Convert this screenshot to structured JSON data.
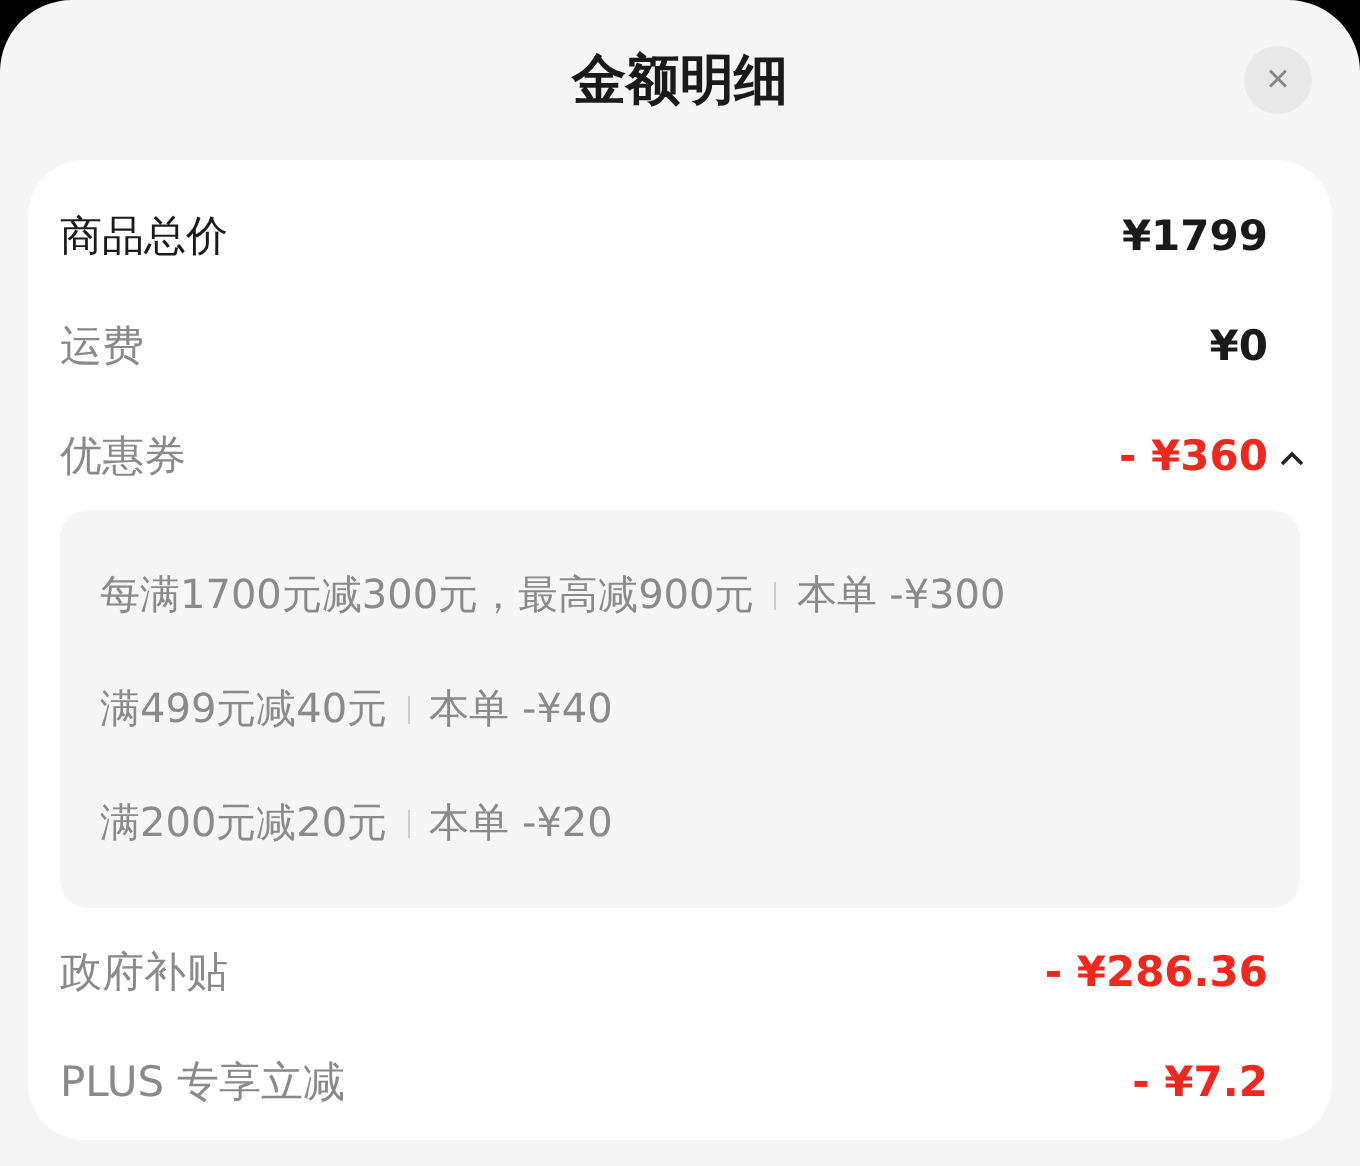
{
  "title": "金额明细",
  "close": "×",
  "rows": [
    {
      "label": "商品总价",
      "value": "¥1799",
      "kind": "total"
    },
    {
      "label": "运费",
      "value": "¥0",
      "kind": "charge"
    },
    {
      "label": "优惠券",
      "value": "- ¥360",
      "kind": "discount",
      "expanded": true,
      "details": [
        {
          "rule": "每满1700元减300元，最高减900元",
          "amount": "本单 -¥300"
        },
        {
          "rule": "满499元减40元",
          "amount": "本单 -¥40"
        },
        {
          "rule": "满200元减20元",
          "amount": "本单 -¥20"
        }
      ]
    },
    {
      "label": "政府补贴",
      "value": "- ¥286.36",
      "kind": "discount"
    },
    {
      "label": "PLUS 专享立减",
      "value": "- ¥7.2",
      "kind": "discount"
    }
  ]
}
